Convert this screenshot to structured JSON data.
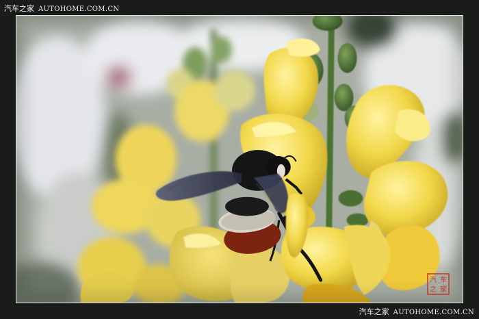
{
  "watermark_top": {
    "cn": "汽车之家",
    "en": "AUTOHOME.COM.CN"
  },
  "watermark_bottom": {
    "cn": "汽车之家",
    "en": "AUTOHOME.COM.CN"
  },
  "colors": {
    "border": "#e8e8e8",
    "background": "#1a1c1a",
    "petal": "#f2d84a",
    "petal_light": "#fbec8a",
    "bee_body": "#151515",
    "bee_band": "#8a2a0c",
    "seal": "#c0392b"
  },
  "seal_glyphs": [
    "汽",
    "车",
    "之",
    "家"
  ]
}
